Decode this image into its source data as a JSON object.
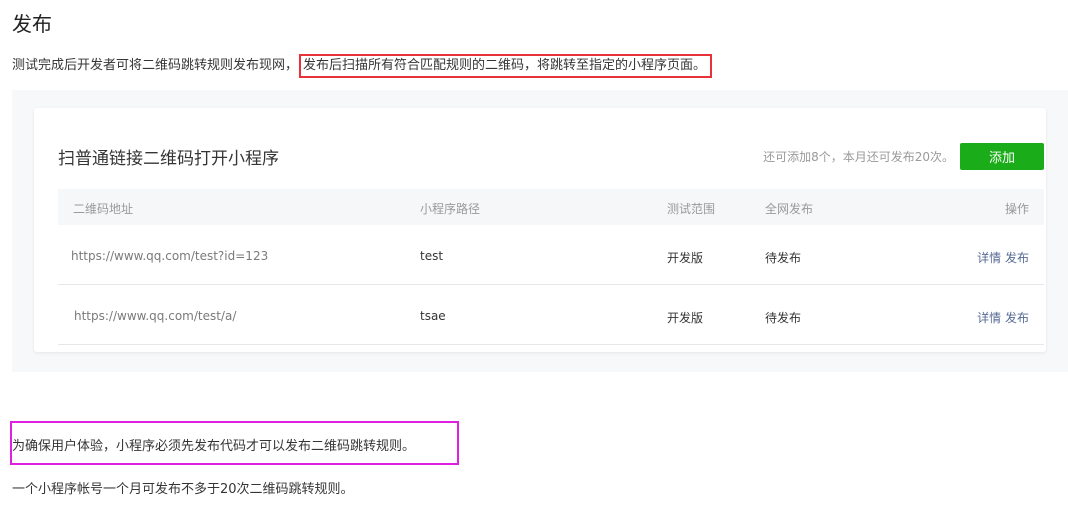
{
  "page": {
    "title": "发布",
    "intro_plain": "测试完成后开发者可将二维码跳转规则发布现网，",
    "intro_highlight": "发布后扫描所有符合匹配规则的二维码，将跳转至指定的小程序页面。"
  },
  "card": {
    "title": "扫普通链接二维码打开小程序",
    "quota": "还可添加8个，本月还可发布20次。",
    "add_label": "添加",
    "accent_color": "#1aad19"
  },
  "table": {
    "headers": [
      "二维码地址",
      "小程序路径",
      "测试范围",
      "全网发布",
      "操作"
    ],
    "rows": [
      {
        "url": "https://www.qq.com/test?id=123",
        "path": "test",
        "scope": "开发版",
        "status": "待发布",
        "details": "详情",
        "publish": "发布"
      },
      {
        "url": "https://www.qq.com/test/a/",
        "path": "tsae",
        "scope": "开发版",
        "status": "待发布",
        "details": "详情",
        "publish": "发布"
      }
    ]
  },
  "notes": {
    "note1": "为确保用户体验，小程序必须先发布代码才可以发布二维码跳转规则。",
    "note2": "一个小程序帐号一个月可发布不多于20次二维码跳转规则。"
  }
}
